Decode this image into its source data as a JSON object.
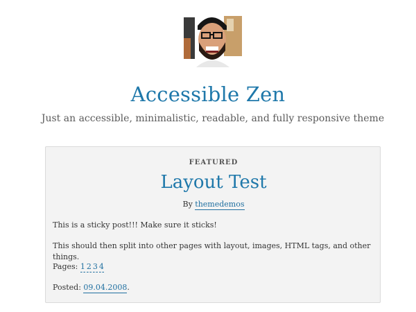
{
  "site": {
    "title": "Accessible Zen",
    "description": "Just an accessible, minimalistic, readable, and fully responsive theme"
  },
  "post": {
    "featured_label": "FEATURED",
    "title": "Layout Test",
    "byline_prefix": "By",
    "author": "themedemos",
    "paragraph1": "This is a sticky post!!! Make sure it sticks!",
    "paragraph2": "This should then split into other pages with layout, images, HTML tags, and other things.",
    "pages_label": "Pages:",
    "pages": [
      "1",
      "2",
      "3",
      "4"
    ],
    "posted_label": "Posted:",
    "posted_date": "09.04.2008",
    "posted_suffix": "."
  },
  "colors": {
    "link": "#1f78aa",
    "post_background": "#f3f3f3",
    "post_border": "#dadada"
  }
}
